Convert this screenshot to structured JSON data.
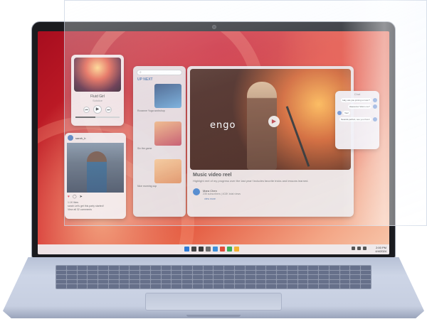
{
  "music": {
    "title": "Fluid Girl",
    "artist": "Solstice",
    "progress": 0.45,
    "prev_icon": "⏮",
    "play_icon": "▶",
    "next_icon": "⏭"
  },
  "social": {
    "user": "sarah_b",
    "likes": "1.1K likes",
    "caption": "sarah Let's get this party started!",
    "comments_link": "View all 32 comments"
  },
  "upnext": {
    "search_placeholder": "",
    "title": "UP NEXT",
    "items": [
      {
        "caption": "Roxanne  Yoga workshop",
        "color_top": "#2c4a7a",
        "color_bottom": "#6aa7d8"
      },
      {
        "caption": "Six the game",
        "color_top": "#f0b27a",
        "color_bottom": "#c2455b"
      },
      {
        "caption": "Nice morning cup",
        "color_top": "#f6c48f",
        "color_bottom": "#e08b5a"
      }
    ]
  },
  "player": {
    "brand": "engo",
    "video_title": "Music video reel",
    "description": "Highlight reel of my progress over the last year! Includes favorite tricks and lessons learned.",
    "channel_name": "Mara Chen",
    "channel_stats": "235 subscribers | 402K total views",
    "view_more": "view more"
  },
  "chat": {
    "title": "Chat",
    "messages": [
      {
        "text": "Hey, are you joining us later?",
        "side": "right"
      },
      {
        "text": "Awesome! Want one?",
        "side": "right"
      },
      {
        "text": "Yes!",
        "side": "left"
      },
      {
        "text": "Sounds perfect, see you there!",
        "side": "right"
      }
    ]
  },
  "taskbar": {
    "time": "2:00 PM",
    "date": "4/4/2024",
    "icon_colors": [
      "#2e7bd6",
      "#444444",
      "#3a3a3a",
      "#6b6b6b",
      "#3d8fd9",
      "#e04d3a",
      "#3cae5a",
      "#f2b233"
    ]
  }
}
